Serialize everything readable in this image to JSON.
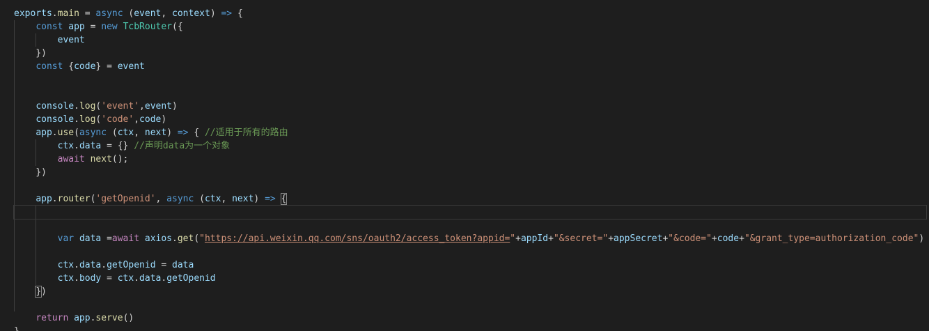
{
  "theme": {
    "background": "#1e1e1e",
    "keyword": "#569cd6",
    "control": "#c586c0",
    "variable": "#9cdcfe",
    "function": "#dcdcaa",
    "class": "#4ec9b0",
    "string": "#ce9178",
    "comment": "#6a9955",
    "plain": "#d4d4d4"
  },
  "editor": {
    "lines": [
      [
        [
          "var",
          "exports"
        ],
        [
          "plain",
          "."
        ],
        [
          "func",
          "main"
        ],
        [
          "plain",
          " = "
        ],
        [
          "keyword",
          "async"
        ],
        [
          "plain",
          " ("
        ],
        [
          "var",
          "event"
        ],
        [
          "plain",
          ", "
        ],
        [
          "var",
          "context"
        ],
        [
          "plain",
          ") "
        ],
        [
          "keyword",
          "=>"
        ],
        [
          "plain",
          " {"
        ]
      ],
      [
        [
          "plain",
          "    "
        ],
        [
          "keyword",
          "const"
        ],
        [
          "plain",
          " "
        ],
        [
          "var",
          "app"
        ],
        [
          "plain",
          " = "
        ],
        [
          "keyword",
          "new"
        ],
        [
          "plain",
          " "
        ],
        [
          "class",
          "TcbRouter"
        ],
        [
          "plain",
          "({"
        ]
      ],
      [
        [
          "plain",
          "        "
        ],
        [
          "var",
          "event"
        ]
      ],
      [
        [
          "plain",
          "    })"
        ]
      ],
      [
        [
          "plain",
          "    "
        ],
        [
          "keyword",
          "const"
        ],
        [
          "plain",
          " {"
        ],
        [
          "var",
          "code"
        ],
        [
          "plain",
          "} = "
        ],
        [
          "var",
          "event"
        ]
      ],
      [],
      [],
      [
        [
          "plain",
          "    "
        ],
        [
          "var",
          "console"
        ],
        [
          "plain",
          "."
        ],
        [
          "func",
          "log"
        ],
        [
          "plain",
          "("
        ],
        [
          "string",
          "'event'"
        ],
        [
          "plain",
          ","
        ],
        [
          "var",
          "event"
        ],
        [
          "plain",
          ")"
        ]
      ],
      [
        [
          "plain",
          "    "
        ],
        [
          "var",
          "console"
        ],
        [
          "plain",
          "."
        ],
        [
          "func",
          "log"
        ],
        [
          "plain",
          "("
        ],
        [
          "string",
          "'code'"
        ],
        [
          "plain",
          ","
        ],
        [
          "var",
          "code"
        ],
        [
          "plain",
          ")"
        ]
      ],
      [
        [
          "plain",
          "    "
        ],
        [
          "var",
          "app"
        ],
        [
          "plain",
          "."
        ],
        [
          "func",
          "use"
        ],
        [
          "plain",
          "("
        ],
        [
          "keyword",
          "async"
        ],
        [
          "plain",
          " ("
        ],
        [
          "var",
          "ctx"
        ],
        [
          "plain",
          ", "
        ],
        [
          "var",
          "next"
        ],
        [
          "plain",
          ") "
        ],
        [
          "keyword",
          "=>"
        ],
        [
          "plain",
          " { "
        ],
        [
          "comment",
          "//适用于所有的路由"
        ]
      ],
      [
        [
          "plain",
          "        "
        ],
        [
          "var",
          "ctx"
        ],
        [
          "plain",
          "."
        ],
        [
          "var",
          "data"
        ],
        [
          "plain",
          " = {} "
        ],
        [
          "comment",
          "//声明data为一个对象"
        ]
      ],
      [
        [
          "plain",
          "        "
        ],
        [
          "control",
          "await"
        ],
        [
          "plain",
          " "
        ],
        [
          "func",
          "next"
        ],
        [
          "plain",
          "();"
        ]
      ],
      [
        [
          "plain",
          "    })"
        ]
      ],
      [],
      [
        [
          "plain",
          "    "
        ],
        [
          "var",
          "app"
        ],
        [
          "plain",
          "."
        ],
        [
          "func",
          "router"
        ],
        [
          "plain",
          "("
        ],
        [
          "string",
          "'getOpenid'"
        ],
        [
          "plain",
          ", "
        ],
        [
          "keyword",
          "async"
        ],
        [
          "plain",
          " ("
        ],
        [
          "var",
          "ctx"
        ],
        [
          "plain",
          ", "
        ],
        [
          "var",
          "next"
        ],
        [
          "plain",
          ") "
        ],
        [
          "keyword",
          "=>"
        ],
        [
          "plain",
          " "
        ],
        [
          "bracket",
          "{"
        ]
      ],
      [],
      [],
      [
        [
          "plain",
          "        "
        ],
        [
          "keyword",
          "var"
        ],
        [
          "plain",
          " "
        ],
        [
          "var",
          "data"
        ],
        [
          "plain",
          " ="
        ],
        [
          "control",
          "await"
        ],
        [
          "plain",
          " "
        ],
        [
          "var",
          "axios"
        ],
        [
          "plain",
          "."
        ],
        [
          "func",
          "get"
        ],
        [
          "plain",
          "("
        ],
        [
          "string",
          "\""
        ],
        [
          "link",
          "https://api.weixin.qq.com/sns/oauth2/access_token?appid="
        ],
        [
          "string",
          "\""
        ],
        [
          "plain",
          "+"
        ],
        [
          "var",
          "appId"
        ],
        [
          "plain",
          "+"
        ],
        [
          "string",
          "\"&secret=\""
        ],
        [
          "plain",
          "+"
        ],
        [
          "var",
          "appSecret"
        ],
        [
          "plain",
          "+"
        ],
        [
          "string",
          "\"&code=\""
        ],
        [
          "plain",
          "+"
        ],
        [
          "var",
          "code"
        ],
        [
          "plain",
          "+"
        ],
        [
          "string",
          "\"&grant_type=authorization_code\""
        ],
        [
          "plain",
          ")"
        ]
      ],
      [],
      [
        [
          "plain",
          "        "
        ],
        [
          "var",
          "ctx"
        ],
        [
          "plain",
          "."
        ],
        [
          "var",
          "data"
        ],
        [
          "plain",
          "."
        ],
        [
          "var",
          "getOpenid"
        ],
        [
          "plain",
          " = "
        ],
        [
          "var",
          "data"
        ]
      ],
      [
        [
          "plain",
          "        "
        ],
        [
          "var",
          "ctx"
        ],
        [
          "plain",
          "."
        ],
        [
          "var",
          "body"
        ],
        [
          "plain",
          " = "
        ],
        [
          "var",
          "ctx"
        ],
        [
          "plain",
          "."
        ],
        [
          "var",
          "data"
        ],
        [
          "plain",
          "."
        ],
        [
          "var",
          "getOpenid"
        ]
      ],
      [
        [
          "plain",
          "    "
        ],
        [
          "bracket",
          "}"
        ],
        [
          "plain",
          ")"
        ]
      ],
      [],
      [
        [
          "plain",
          "    "
        ],
        [
          "control",
          "return"
        ],
        [
          "plain",
          " "
        ],
        [
          "var",
          "app"
        ],
        [
          "plain",
          "."
        ],
        [
          "func",
          "serve"
        ],
        [
          "plain",
          "()"
        ]
      ],
      [
        [
          "plain",
          "}"
        ]
      ]
    ],
    "current_line_index": 15
  }
}
